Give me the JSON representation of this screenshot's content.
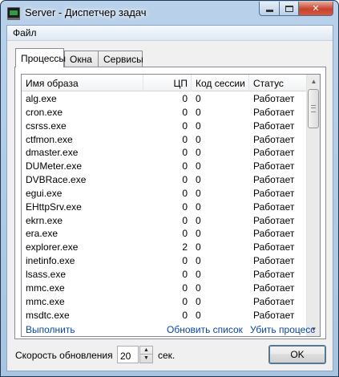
{
  "window": {
    "title": "Server - Диспетчер задач"
  },
  "menu": {
    "items": [
      "Файл"
    ]
  },
  "tabs": [
    "Процессы",
    "Окна",
    "Сервисы"
  ],
  "columns": {
    "name": "Имя образа",
    "cpu": "ЦП",
    "session": "Код сессии",
    "status": "Статус"
  },
  "processes": [
    {
      "name": "alg.exe",
      "cpu": "0",
      "session": "0",
      "status": "Работает"
    },
    {
      "name": "cron.exe",
      "cpu": "0",
      "session": "0",
      "status": "Работает"
    },
    {
      "name": "csrss.exe",
      "cpu": "0",
      "session": "0",
      "status": "Работает"
    },
    {
      "name": "ctfmon.exe",
      "cpu": "0",
      "session": "0",
      "status": "Работает"
    },
    {
      "name": "dmaster.exe",
      "cpu": "0",
      "session": "0",
      "status": "Работает"
    },
    {
      "name": "DUMeter.exe",
      "cpu": "0",
      "session": "0",
      "status": "Работает"
    },
    {
      "name": "DVBRace.exe",
      "cpu": "0",
      "session": "0",
      "status": "Работает"
    },
    {
      "name": "egui.exe",
      "cpu": "0",
      "session": "0",
      "status": "Работает"
    },
    {
      "name": "EHttpSrv.exe",
      "cpu": "0",
      "session": "0",
      "status": "Работает"
    },
    {
      "name": "ekrn.exe",
      "cpu": "0",
      "session": "0",
      "status": "Работает"
    },
    {
      "name": "era.exe",
      "cpu": "0",
      "session": "0",
      "status": "Работает"
    },
    {
      "name": "explorer.exe",
      "cpu": "2",
      "session": "0",
      "status": "Работает"
    },
    {
      "name": "inetinfo.exe",
      "cpu": "0",
      "session": "0",
      "status": "Работает"
    },
    {
      "name": "lsass.exe",
      "cpu": "0",
      "session": "0",
      "status": "Работает"
    },
    {
      "name": "mmc.exe",
      "cpu": "0",
      "session": "0",
      "status": "Работает"
    },
    {
      "name": "mmc.exe",
      "cpu": "0",
      "session": "0",
      "status": "Работает"
    },
    {
      "name": "msdtc.exe",
      "cpu": "0",
      "session": "0",
      "status": "Работает"
    }
  ],
  "actions": {
    "run": "Выполнить",
    "refresh": "Обновить список",
    "kill": "Убить процесс"
  },
  "refresh_speed": {
    "label": "Скорость обновления",
    "value": "20",
    "unit": "сек."
  },
  "ok_label": "OK",
  "colors": {
    "link": "#0a47a3",
    "titlebar": "#b9d1ea",
    "close_button": "#c7432c"
  },
  "icons": [
    "app-icon",
    "minimize-icon",
    "maximize-icon",
    "close-icon",
    "scroll-up-icon",
    "scroll-down-icon",
    "spin-up-icon",
    "spin-down-icon"
  ]
}
